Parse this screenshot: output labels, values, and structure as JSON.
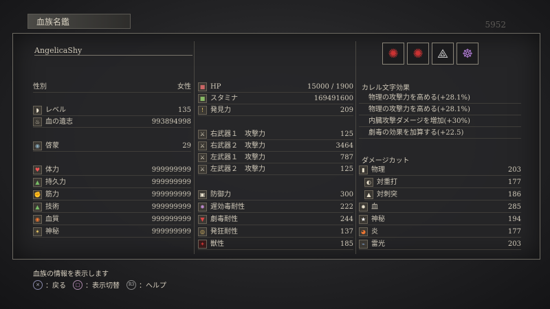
{
  "window": {
    "tab_title": "血族名鑑",
    "bg_number": "5952"
  },
  "character": {
    "name": "AngelicaShy"
  },
  "col1": {
    "gender_label": "性別",
    "gender_value": "女性",
    "level": {
      "label": "レベル",
      "value": "135",
      "icon": "level-icon"
    },
    "echoes": {
      "label": "血の遺志",
      "value": "993894998",
      "icon": "echoes-icon"
    },
    "insight": {
      "label": "啓蒙",
      "value": "29",
      "icon": "insight-icon"
    },
    "stats": [
      {
        "label": "体力",
        "value": "999999999",
        "icon": "vitality-icon"
      },
      {
        "label": "持久力",
        "value": "999999999",
        "icon": "endurance-icon"
      },
      {
        "label": "筋力",
        "value": "999999999",
        "icon": "strength-icon"
      },
      {
        "label": "技術",
        "value": "999999999",
        "icon": "skill-icon"
      },
      {
        "label": "血質",
        "value": "999999999",
        "icon": "bloodtinge-icon"
      },
      {
        "label": "神秘",
        "value": "999999999",
        "icon": "arcane-icon"
      }
    ]
  },
  "col2": {
    "hp": {
      "label": "HP",
      "value": "15000 / 1900"
    },
    "stamina": {
      "label": "スタミナ",
      "value": "169491600"
    },
    "discovery": {
      "label": "発見力",
      "value": "209"
    },
    "weapons": [
      {
        "label": "右武器１　攻撃力",
        "value": "125"
      },
      {
        "label": "右武器２　攻撃力",
        "value": "3464"
      },
      {
        "label": "左武器１　攻撃力",
        "value": "787"
      },
      {
        "label": "左武器２　攻撃力",
        "value": "125"
      }
    ],
    "resist": [
      {
        "label": "防御力",
        "value": "300"
      },
      {
        "label": "遅効毒耐性",
        "value": "222"
      },
      {
        "label": "劇毒耐性",
        "value": "244"
      },
      {
        "label": "発狂耐性",
        "value": "137"
      },
      {
        "label": "獣性",
        "value": "185"
      }
    ]
  },
  "col3": {
    "rune_header": "カレル文字効果",
    "rune_effects": [
      "物理の攻撃力を高める(+28.1%)",
      "物理の攻撃力を高める(+28.1%)",
      "内臓攻撃ダメージを増加(+30%)",
      "劇毒の効果を加算する(+22.5)"
    ],
    "damage_header": "ダメージカット",
    "damage": [
      {
        "label": "物理",
        "value": "203",
        "indent": false
      },
      {
        "label": "対重打",
        "value": "177",
        "indent": true
      },
      {
        "label": "対刺突",
        "value": "186",
        "indent": true
      },
      {
        "label": "血",
        "value": "285",
        "indent": false
      },
      {
        "label": "神秘",
        "value": "194",
        "indent": false
      },
      {
        "label": "炎",
        "value": "177",
        "indent": false
      },
      {
        "label": "雷光",
        "value": "203",
        "indent": false
      }
    ]
  },
  "footer": {
    "info": "血族の情報を表示します",
    "back": "：戻る",
    "toggle": "：表示切替",
    "help": "：ヘルプ",
    "back_glyph": "✕",
    "toggle_glyph": "□",
    "help_glyph": "R3"
  }
}
